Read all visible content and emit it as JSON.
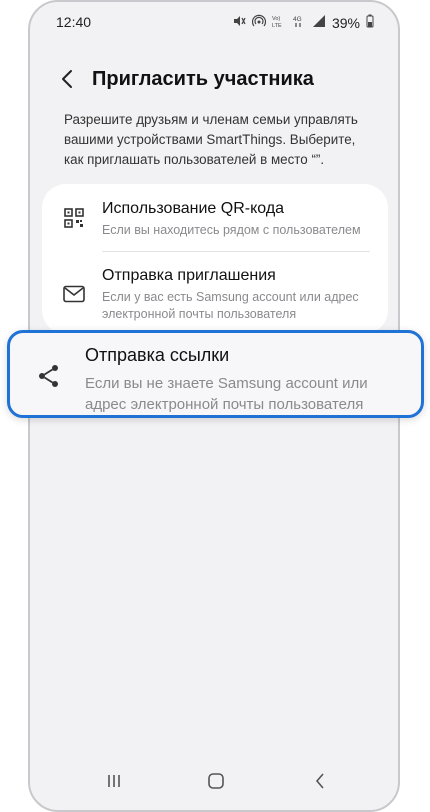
{
  "status_bar": {
    "time": "12:40",
    "battery": "39%",
    "icons": [
      "mute-icon",
      "hotspot-icon",
      "volte-icon",
      "4g-icon",
      "signal-icon"
    ]
  },
  "header": {
    "title": "Пригласить участника"
  },
  "description": "Разрешите друзьям и членам семьи управлять вашими устройствами SmartThings. Выберите, как приглашать пользователей в место “”.",
  "options": [
    {
      "title": "Использование QR-кода",
      "subtitle": "Если вы находитесь рядом с пользователем",
      "icon": "qr-code-icon"
    },
    {
      "title": "Отправка приглашения",
      "subtitle": "Если у вас есть Samsung account или адрес электронной почты пользователя",
      "icon": "mail-icon"
    }
  ],
  "highlighted_option": {
    "title": "Отправка ссылки",
    "subtitle": "Если вы не знаете Samsung account или адрес электронной почты пользователя",
    "icon": "share-icon"
  },
  "colors": {
    "background": "#f2f2f4",
    "card": "#ffffff",
    "highlight_border": "#1f73d6",
    "secondary_text": "#8a8a8e"
  }
}
